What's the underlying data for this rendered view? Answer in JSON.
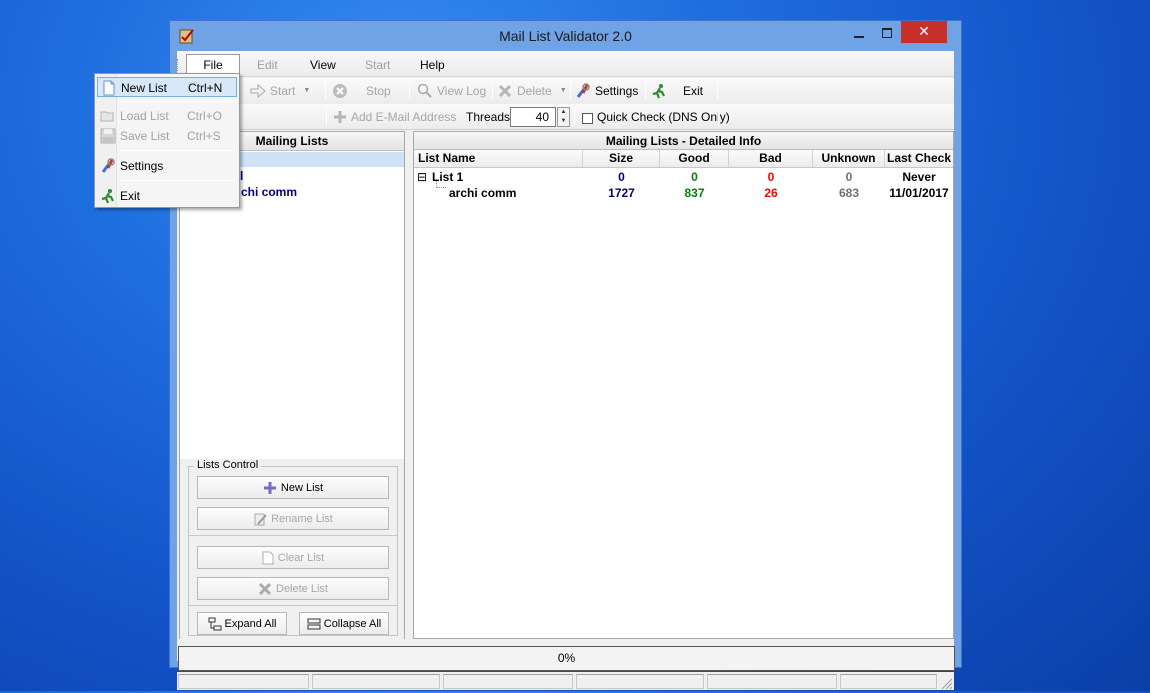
{
  "window": {
    "title": "Mail List Validator 2.0",
    "close_glyph": "✕"
  },
  "menubar": {
    "items": [
      "File",
      "Edit",
      "View",
      "Start",
      "Help"
    ]
  },
  "toolbar1": {
    "start": "Start",
    "stop": "Stop",
    "view_log": "View Log",
    "delete": "Delete",
    "settings": "Settings",
    "exit": "Exit"
  },
  "toolbar2": {
    "add_email": "Add E-Mail Address",
    "threads_label": "Threads",
    "threads_value": "40",
    "quick_check": "Quick Check (DNS Only)"
  },
  "left_panel": {
    "header": "Mailing Lists",
    "tree_visible": [
      "l",
      "chi comm"
    ]
  },
  "lists_control": {
    "title": "Lists Control",
    "new_list": "New List",
    "rename_list": "Rename List",
    "clear_list": "Clear List",
    "delete_list": "Delete List",
    "expand_all": "Expand All",
    "collapse_all": "Collapse All"
  },
  "right_panel": {
    "header": "Mailing Lists - Detailed Info",
    "columns": [
      "List Name",
      "Size",
      "Good",
      "Bad",
      "Unknown",
      "Last Check"
    ],
    "rows": [
      {
        "name": "List 1",
        "size": "0",
        "good": "0",
        "bad": "0",
        "unknown": "0",
        "last_check": "Never",
        "expand_glyph": "⊟"
      },
      {
        "name": "archi comm",
        "size": "1727",
        "good": "837",
        "bad": "26",
        "unknown": "683",
        "last_check": "11/01/2017"
      }
    ]
  },
  "progress": {
    "text": "0%"
  },
  "file_menu": {
    "items": [
      {
        "label": "New List",
        "shortcut": "Ctrl+N",
        "icon": "new-document-icon"
      },
      {
        "label": "Load List",
        "shortcut": "Ctrl+O",
        "icon": "folder-open-icon"
      },
      {
        "label": "Save List",
        "shortcut": "Ctrl+S",
        "icon": "floppy-disk-icon"
      },
      {
        "label": "Settings",
        "icon": "tools-icon"
      },
      {
        "label": "Exit",
        "icon": "exit-running-man-icon"
      }
    ]
  },
  "colors": {
    "navy": "#000080",
    "good_green": "#008000",
    "bad_red": "#ff0000",
    "unknown_gray": "#707070",
    "close_red": "#c7302b"
  }
}
